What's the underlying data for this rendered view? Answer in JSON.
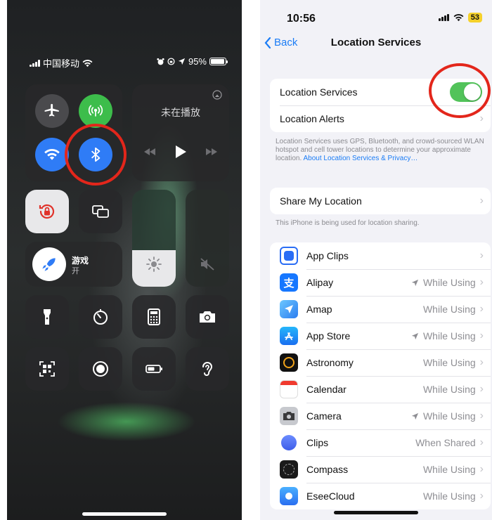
{
  "control_center": {
    "status_bar": {
      "carrier": "中国移动",
      "battery": "95%"
    },
    "now_playing": "未在播放",
    "game_mode": {
      "title": "游戏",
      "subtitle": "开"
    },
    "colors": {
      "blue": "#2f7cf6",
      "green": "#3dbd4b",
      "highlight": "#e3261b"
    }
  },
  "settings": {
    "status_bar": {
      "time": "10:56",
      "battery": "53"
    },
    "nav": {
      "back": "Back",
      "title": "Location Services"
    },
    "location_group": [
      {
        "label": "Location Services"
      },
      {
        "label": "Location Alerts"
      }
    ],
    "location_note": "Location Services uses GPS, Bluetooth, and crowd-sourced WLAN hotspot and cell tower locations to determine your approximate location.",
    "location_note_link": "About Location Services & Privacy…",
    "share": {
      "label": "Share My Location"
    },
    "share_note": "This iPhone is being used for location sharing.",
    "apps": [
      {
        "name": "App Clips",
        "status": "",
        "arrow": false,
        "icon": "app-clips-icon",
        "color": "#2a6df5"
      },
      {
        "name": "Alipay",
        "status": "While Using",
        "arrow": true,
        "icon": "alipay-icon",
        "color": "#1677ff"
      },
      {
        "name": "Amap",
        "status": "While Using",
        "arrow": false,
        "icon": "amap-icon",
        "color": "#3aa6f5"
      },
      {
        "name": "App Store",
        "status": "While Using",
        "arrow": true,
        "icon": "app-store-icon",
        "color": "#1b8cf6"
      },
      {
        "name": "Astronomy",
        "status": "While Using",
        "arrow": false,
        "icon": "astronomy-icon",
        "color": "#111111"
      },
      {
        "name": "Calendar",
        "status": "While Using",
        "arrow": false,
        "icon": "calendar-icon",
        "color": "#ffffff"
      },
      {
        "name": "Camera",
        "status": "While Using",
        "arrow": true,
        "icon": "camera-icon",
        "color": "#b9bcc2"
      },
      {
        "name": "Clips",
        "status": "When Shared",
        "arrow": false,
        "icon": "clips-icon",
        "color": "#3e6df0"
      },
      {
        "name": "Compass",
        "status": "While Using",
        "arrow": false,
        "icon": "compass-icon",
        "color": "#1a1a1a"
      },
      {
        "name": "EseeCloud",
        "status": "While Using",
        "arrow": false,
        "icon": "eseecloud-icon",
        "color": "#2a8cf6"
      }
    ]
  }
}
